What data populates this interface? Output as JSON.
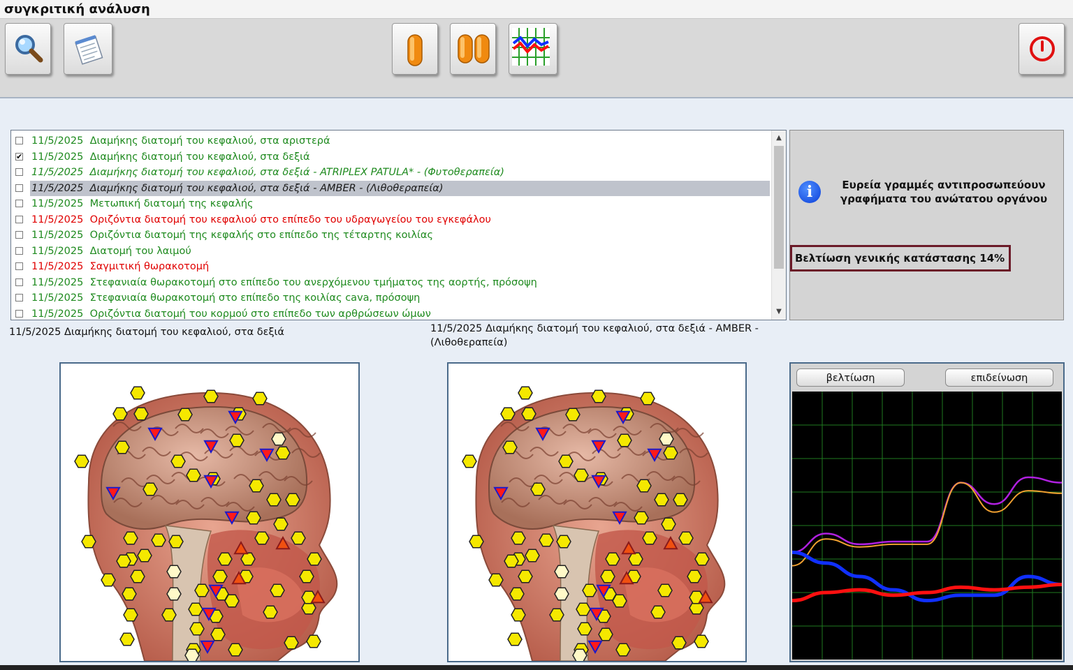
{
  "window": {
    "title": "συγκριτική ανάλυση"
  },
  "toolbar": {
    "buttons": [
      {
        "name": "search",
        "icon": "magnifier-icon"
      },
      {
        "name": "report",
        "icon": "notepad-icon"
      },
      {
        "name": "single-view",
        "icon": "single-capsule-icon"
      },
      {
        "name": "compare-view",
        "icon": "double-capsule-icon"
      },
      {
        "name": "graph-view",
        "icon": "chart-icon"
      },
      {
        "name": "exit",
        "icon": "power-icon"
      }
    ]
  },
  "list": {
    "items": [
      {
        "date": "11/5/2025",
        "text": "Διαμήκης διατομή του κεφαλιού, στα αριστερά",
        "color": "#1e8a1e",
        "checked": false,
        "italic": false,
        "selected": false
      },
      {
        "date": "11/5/2025",
        "text": "Διαμήκης διατομή του κεφαλιού, στα δεξιά",
        "color": "#1e8a1e",
        "checked": true,
        "italic": false,
        "selected": false
      },
      {
        "date": "11/5/2025",
        "text": "Διαμήκης διατομή του κεφαλιού, στα δεξιά - ATRIPLEX  PATULA* - (Φυτοθεραπεία)",
        "color": "#1e8a1e",
        "checked": false,
        "italic": true,
        "selected": false
      },
      {
        "date": "11/5/2025",
        "text": "Διαμήκης διατομή του κεφαλιού, στα δεξιά - AMBER - (Λιθοθεραπεία)",
        "color": "#1a1a1a",
        "checked": false,
        "italic": true,
        "selected": true
      },
      {
        "date": "11/5/2025",
        "text": "Μετωπική διατομή της κεφαλής",
        "color": "#1e8a1e",
        "checked": false,
        "italic": false,
        "selected": false
      },
      {
        "date": "11/5/2025",
        "text": "Οριζόντια διατομή του κεφαλιού στο επίπεδο του υδραγωγείου του εγκεφάλου",
        "color": "#e00000",
        "checked": false,
        "italic": false,
        "selected": false
      },
      {
        "date": "11/5/2025",
        "text": "Οριζόντια διατομή της κεφαλής στο επίπεδο της τέταρτης κοιλίας",
        "color": "#1e8a1e",
        "checked": false,
        "italic": false,
        "selected": false
      },
      {
        "date": "11/5/2025",
        "text": "Διατομή του λαιμού",
        "color": "#1e8a1e",
        "checked": false,
        "italic": false,
        "selected": false
      },
      {
        "date": "11/5/2025",
        "text": "Σαγμιτική θωρακοτομή",
        "color": "#e00000",
        "checked": false,
        "italic": false,
        "selected": false
      },
      {
        "date": "11/5/2025",
        "text": "Στεφανιαία θωρακοτομή στο επίπεδο του ανερχόμενου τμήματος της αορτής, πρόσοψη",
        "color": "#1e8a1e",
        "checked": false,
        "italic": false,
        "selected": false
      },
      {
        "date": "11/5/2025",
        "text": "Στεφανιαία θωρακοτομή στο επίπεδο της κοιλίας cava, πρόσοψη",
        "color": "#1e8a1e",
        "checked": false,
        "italic": false,
        "selected": false
      },
      {
        "date": "11/5/2025",
        "text": "Οριζόντια διατομή του κορμού στο επίπεδο των αρθρώσεων ώμων",
        "color": "#1e8a1e",
        "checked": false,
        "italic": false,
        "selected": false
      }
    ]
  },
  "info": {
    "message": "Ευρεία γραμμές αντιπροσωπεύουν γραφήματα του ανώτατου οργάνου",
    "improvement": "Βελτίωση γενικής κατάστασης 14%"
  },
  "captions": {
    "left": "11/5/2025  Διαμήκης διατομή του κεφαλιού, στα δεξιά",
    "right_line1": "11/5/2025  Διαμήκης διατομή του κεφαλιού, στα δεξιά - AMBER -",
    "right_line2": "(Λιθοθεραπεία)"
  },
  "graph": {
    "improve_button": "βελτίωση",
    "worsen_button": "επιδείνωση",
    "colors": {
      "background": "#000000",
      "grid": "#1f7a1f",
      "purple": "#b020e0",
      "orange": "#f0a030",
      "blue": "#1030ff",
      "red": "#ff1010"
    },
    "series": [
      {
        "color": "#b020e0",
        "width": 2.5,
        "values": [
          0.4,
          0.47,
          0.43,
          0.44,
          0.44,
          0.66,
          0.58,
          0.68,
          0.66
        ]
      },
      {
        "color": "#f0a030",
        "width": 2,
        "values": [
          0.35,
          0.45,
          0.42,
          0.43,
          0.43,
          0.66,
          0.55,
          0.63,
          0.62
        ]
      },
      {
        "color": "#1030ff",
        "width": 5,
        "values": [
          0.4,
          0.36,
          0.31,
          0.26,
          0.22,
          0.24,
          0.24,
          0.31,
          0.28
        ]
      },
      {
        "color": "#ff1010",
        "width": 5,
        "values": [
          0.22,
          0.25,
          0.26,
          0.24,
          0.25,
          0.27,
          0.26,
          0.27,
          0.28
        ]
      }
    ]
  }
}
